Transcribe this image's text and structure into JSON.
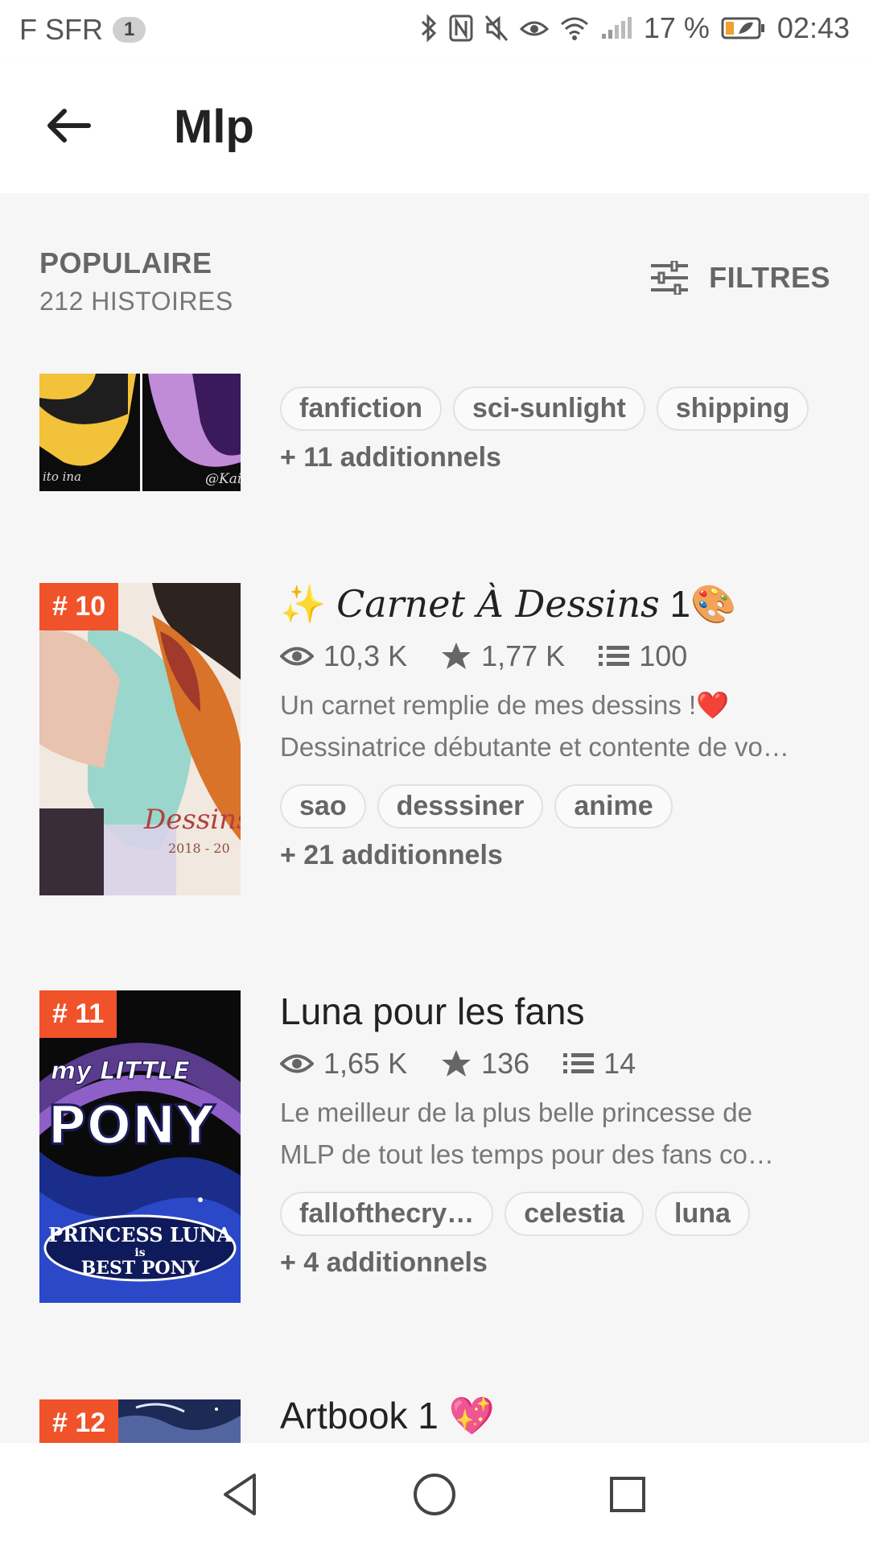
{
  "status_bar": {
    "carrier": "F SFR",
    "sim_badge": "1",
    "battery_percent": "17 %",
    "time": "02:43"
  },
  "app_bar": {
    "title": "Mlp"
  },
  "list_header": {
    "sort_label": "POPULAIRE",
    "story_count": "212 HISTOIRES",
    "filters_label": "FILTRES"
  },
  "stories": [
    {
      "tags": [
        "fanfiction",
        "sci-sunlight",
        "shipping"
      ],
      "more": "+ 11 additionnels"
    },
    {
      "rank": "# 10",
      "title_prefix": "✨",
      "title_script": "Carnet À Dessins",
      "title_suffix": "1🎨",
      "reads": "10,3 K",
      "votes": "1,77 K",
      "parts": "100",
      "description": [
        "Un carnet remplie de mes dessins !❤️",
        "Dessinatrice débutante et contente de vo…"
      ],
      "tags": [
        "sao",
        "desssiner",
        "anime"
      ],
      "more": "+ 21 additionnels"
    },
    {
      "rank": "# 11",
      "title": "Luna pour les fans",
      "reads": "1,65 K",
      "votes": "136",
      "parts": "14",
      "description": [
        "Le meilleur de la plus belle princesse de",
        "MLP de tout les temps pour des fans co…"
      ],
      "tags": [
        "fallofthecry…",
        "celestia",
        "luna"
      ],
      "more": "+ 4 additionnels"
    },
    {
      "rank": "# 12",
      "title": "Artbook 1 💖"
    }
  ],
  "cover_text": {
    "story1_left": "ito ina",
    "story1_right": "@Kai",
    "story2": "Dessins",
    "story2_year": "2018 - 20",
    "story3_line1": "my LITTLE",
    "story3_line2": "PONY",
    "story3_line3": "PRINCESS LUNA",
    "story3_line4": "is",
    "story3_line5": "BEST PONY"
  },
  "colors": {
    "accent": "#f0522a",
    "background": "#f6f6f6",
    "text_secondary": "#666666"
  }
}
